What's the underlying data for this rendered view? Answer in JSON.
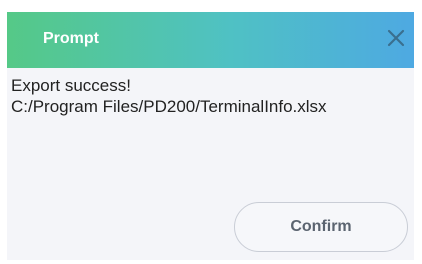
{
  "dialog": {
    "title": "Prompt",
    "close_icon": "close-icon",
    "message_lines": [
      "Export success!",
      "C:/Program Files/PD200/TerminalInfo.xlsx"
    ],
    "confirm_label": "Confirm"
  },
  "colors": {
    "titlebar_gradient": [
      "#55c987",
      "#4fc1c4",
      "#4ea9e2"
    ],
    "body_background": "#f4f5f9",
    "button_text": "#5b6470"
  }
}
